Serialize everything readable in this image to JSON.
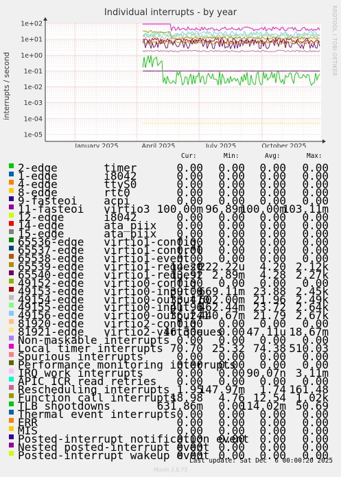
{
  "page": {
    "title": "Individual interrupts - by year",
    "ylabel": "interrupts / second",
    "side_text": "RRDTOOL / TOBI OETIKER",
    "headers": [
      "Cur:",
      "Min:",
      "Avg:",
      "Max:"
    ],
    "last_update": "Last update: Sat Dec  6 00:00:20 2025",
    "munin": "Munin 2.0.73"
  },
  "chart_data": {
    "type": "line",
    "title": "Individual interrupts - by year",
    "xlabel": "",
    "ylabel": "interrupts / second",
    "y_scale": "log",
    "ylim": [
      1e-05,
      100
    ],
    "y_ticks": [
      "1e+02",
      "1e+01",
      "1e+00",
      "1e-01",
      "1e-02",
      "1e-03",
      "1e-04",
      "1e-05"
    ],
    "x_ticks": [
      "January 2025",
      "April 2025",
      "July 2025",
      "October 2025"
    ],
    "grid": true,
    "series": [
      {
        "name": "2-edge timer",
        "color": "#00cc00",
        "cur": "0.00",
        "min": "0.00",
        "avg": "0.00",
        "max": "0.00"
      },
      {
        "name": "1-edge i8042",
        "color": "#0066b3",
        "cur": "0.00",
        "min": "0.00",
        "avg": "0.00",
        "max": "0.00"
      },
      {
        "name": "4-edge ttyS0",
        "color": "#ff8000",
        "cur": "0.00",
        "min": "0.00",
        "avg": "0.00",
        "max": "0.00"
      },
      {
        "name": "8-edge rtc0",
        "color": "#ffcc00",
        "cur": "0.00",
        "min": "0.00",
        "avg": "0.00",
        "max": "0.00"
      },
      {
        "name": "9-fasteoi acpi",
        "color": "#330099",
        "cur": "0.00",
        "min": "0.00",
        "avg": "0.00",
        "max": "0.00"
      },
      {
        "name": "11-fasteoi virtio3",
        "color": "#990099",
        "cur": "100.00m",
        "min": "96.89m",
        "avg": "100.00m",
        "max": "103.11m"
      },
      {
        "name": "12-edge i8042",
        "color": "#ccff00",
        "cur": "0.00",
        "min": "0.00",
        "avg": "0.00",
        "max": "0.00"
      },
      {
        "name": "14-edge ata_piix",
        "color": "#ff0000",
        "cur": "0.00",
        "min": "0.00",
        "avg": "0.00",
        "max": "0.00"
      },
      {
        "name": "15-edge ata_piix",
        "color": "#808080",
        "cur": "0.00",
        "min": "0.00",
        "avg": "0.00",
        "max": "0.00"
      },
      {
        "name": "65536-edge virtio1-config",
        "color": "#008f00",
        "cur": "0.00",
        "min": "0.00",
        "avg": "0.00",
        "max": "0.00"
      },
      {
        "name": "65537-edge virtio1-control",
        "color": "#00487d",
        "cur": "0.00",
        "min": "0.00",
        "avg": "0.00",
        "max": "0.00"
      },
      {
        "name": "65538-edge virtio1-event",
        "color": "#b35a00",
        "cur": "0.00",
        "min": "0.00",
        "avg": "0.00",
        "max": "0.00"
      },
      {
        "name": "65539-edge virtio1-request",
        "color": "#b38f00",
        "cur": "14.20",
        "min": "222.22u",
        "avg": "4.20",
        "max": "2.12k"
      },
      {
        "name": "65540-edge virtio1-request",
        "color": "#6b006b",
        "cur": "13.92",
        "min": "2.89m",
        "avg": "4.28",
        "max": "2.27k"
      },
      {
        "name": "49152-edge virtio0-config",
        "color": "#8fb300",
        "cur": "0.00",
        "min": "0.00",
        "avg": "0.00",
        "max": "0.00"
      },
      {
        "name": "49153-edge virtio0-input.0",
        "color": "#b30000",
        "cur": "39.08",
        "min": "669.11m",
        "avg": "23.88",
        "max": "2.45k"
      },
      {
        "name": "49154-edge virtio0-output.0",
        "color": "#bebebe",
        "cur": "33.47",
        "min": "602.00m",
        "avg": "21.96",
        "max": "2.49k"
      },
      {
        "name": "49155-edge virtio0-input.1",
        "color": "#80ff80",
        "cur": "41.96",
        "min": "462.44m",
        "avg": "23.72",
        "max": "2.64k"
      },
      {
        "name": "49156-edge virtio0-output.1",
        "color": "#80c9ff",
        "cur": "36.24",
        "min": "440.67m",
        "avg": "21.79",
        "max": "2.67k"
      },
      {
        "name": "81920-edge virtio2-config",
        "color": "#ffc080",
        "cur": "0.00",
        "min": "0.00",
        "avg": "0.00",
        "max": "0.00"
      },
      {
        "name": "81921-edge virtio2-virtqueues",
        "color": "#ffe680",
        "cur": "46.30u",
        "min": "0.00",
        "avg": "47.11u",
        "max": "18.67m"
      },
      {
        "name": "Non-maskable interrupts",
        "color": "#aa80ff",
        "cur": "0.00",
        "min": "0.00",
        "avg": "0.00",
        "max": "0.00"
      },
      {
        "name": "Local timer interrupts",
        "color": "#ee00cc",
        "cur": "70.70",
        "min": "25.32",
        "avg": "74.38",
        "max": "510.03"
      },
      {
        "name": "Spurious interrupts",
        "color": "#ff8080",
        "cur": "0.00",
        "min": "0.00",
        "avg": "0.00",
        "max": "0.00"
      },
      {
        "name": "Performance monitoring interrupts",
        "color": "#666600",
        "cur": "0.00",
        "min": "0.00",
        "avg": "0.00",
        "max": "0.00"
      },
      {
        "name": "IRQ work interrupts",
        "color": "#ffbfff",
        "cur": "0.00",
        "min": "0.00",
        "avg": "90.07n",
        "max": "3.11m"
      },
      {
        "name": "APIC ICR read retries",
        "color": "#00ffcc",
        "cur": "0.00",
        "min": "0.00",
        "avg": "0.00",
        "max": "0.00"
      },
      {
        "name": "Rescheduling interrupts",
        "color": "#cc6699",
        "cur": "1.95",
        "min": "147.97m",
        "avg": "1.74",
        "max": "161.48"
      },
      {
        "name": "Function call interrupts",
        "color": "#999900",
        "cur": "18.98",
        "min": "4.76",
        "avg": "12.54",
        "max": "1.02k"
      },
      {
        "name": "TLB shootdowns",
        "color": "#00cc00",
        "cur": "631.86m",
        "min": "0.00",
        "avg": "114.02m",
        "max": "50.69"
      },
      {
        "name": "Thermal event interrupts",
        "color": "#0066b3",
        "cur": "0.00",
        "min": "0.00",
        "avg": "0.00",
        "max": "0.00"
      },
      {
        "name": "ERR",
        "color": "#ff8000",
        "cur": "0.00",
        "min": "0.00",
        "avg": "0.00",
        "max": "0.00"
      },
      {
        "name": "MIS",
        "color": "#ffcc00",
        "cur": "0.00",
        "min": "0.00",
        "avg": "0.00",
        "max": "0.00"
      },
      {
        "name": "Posted-interrupt notification event",
        "color": "#330099",
        "cur": "0.00",
        "min": "0.00",
        "avg": "0.00",
        "max": "0.00"
      },
      {
        "name": "Nested posted-interrupt event",
        "color": "#990099",
        "cur": "0.00",
        "min": "0.00",
        "avg": "0.00",
        "max": "0.00"
      },
      {
        "name": "Posted-interrupt wakeup event",
        "color": "#ccff00",
        "cur": "0.00",
        "min": "0.00",
        "avg": "0.00",
        "max": "0.00"
      }
    ]
  }
}
